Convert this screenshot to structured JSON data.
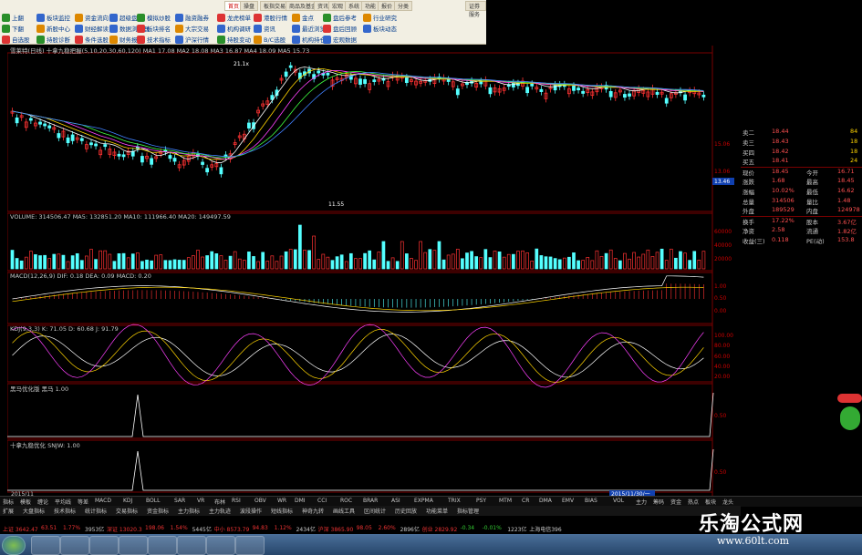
{
  "toolbar": {
    "tabs": [
      "首页",
      "操盘",
      "板指交易",
      "商品及基金",
      "资讯",
      "宏观",
      "系统",
      "功能",
      "报价",
      "分类",
      "证券服务"
    ],
    "active_tab": "首页",
    "items": [
      {
        "label": "上翻",
        "icon": "up-arrow-icon",
        "color": "#2a8f2a"
      },
      {
        "label": "下翻",
        "icon": "down-arrow-icon",
        "color": "#2a8f2a"
      },
      {
        "label": "自选股",
        "icon": "star-icon",
        "color": "#d33"
      },
      {
        "label": "板块监控",
        "icon": "grid-icon",
        "color": "#36c"
      },
      {
        "label": "新股中心",
        "icon": "flag-icon",
        "color": "#d80"
      },
      {
        "label": "持股诊断",
        "icon": "doctor-icon",
        "color": "#2a8f2a"
      },
      {
        "label": "资金流向",
        "icon": "money-icon",
        "color": "#d80"
      },
      {
        "label": "财经解读",
        "icon": "news-icon",
        "color": "#36c"
      },
      {
        "label": "条件选股",
        "icon": "filter-icon",
        "color": "#d33"
      },
      {
        "label": "超级盘口",
        "icon": "monitor-icon",
        "color": "#36c"
      },
      {
        "label": "数据浏览器",
        "icon": "browser-icon",
        "color": "#36c"
      },
      {
        "label": "财务报告",
        "icon": "report-icon",
        "color": "#d80"
      },
      {
        "label": "模拟炒股",
        "icon": "chart-icon",
        "color": "#2a8f2a"
      },
      {
        "label": "板块排名",
        "icon": "rank-icon",
        "color": "#d33"
      },
      {
        "label": "技术指标",
        "icon": "indicator-icon",
        "color": "#d33"
      },
      {
        "label": "融资融券",
        "icon": "loan-icon",
        "color": "#36c"
      },
      {
        "label": "大宗交易",
        "icon": "deal-icon",
        "color": "#d80"
      },
      {
        "label": "沪深行情",
        "icon": "market-icon",
        "color": "#36c"
      },
      {
        "label": "龙虎榜单",
        "icon": "dragon-icon",
        "color": "#d33"
      },
      {
        "label": "机构调研",
        "icon": "org-icon",
        "color": "#36c"
      },
      {
        "label": "持股变动",
        "icon": "change-icon",
        "color": "#2a8f2a"
      },
      {
        "label": "港股行情",
        "icon": "hk-icon",
        "color": "#d33"
      },
      {
        "label": "资讯",
        "icon": "info-icon",
        "color": "#36c"
      },
      {
        "label": "B/C选股",
        "icon": "bc-icon",
        "color": "#d80"
      },
      {
        "label": "金点",
        "icon": "gold-icon",
        "color": "#d80"
      },
      {
        "label": "最近浏览",
        "icon": "history-icon",
        "color": "#36c"
      },
      {
        "label": "机构持仓",
        "icon": "holding-icon",
        "color": "#36c"
      },
      {
        "label": "盘后参考",
        "icon": "reference-icon",
        "color": "#2a8f2a"
      },
      {
        "label": "盘后回顾",
        "icon": "review-icon",
        "color": "#d33"
      },
      {
        "label": "宏观数据",
        "icon": "macro-icon",
        "color": "#36c"
      },
      {
        "label": "行业研究",
        "icon": "industry-icon",
        "color": "#d80"
      },
      {
        "label": "板块动态",
        "icon": "sector-icon",
        "color": "#36c"
      }
    ]
  },
  "main_header": "雪莱特(日线) 十拿九稳把握(5,10,20,30,60,120)  MA1 17.08  MA2 18.08  MA3 16.87  MA4 18.09  MA5 15.73",
  "price_axis": [
    "15.06",
    "13.06"
  ],
  "last_price_tag": "13.46",
  "price_markers": [
    "21.1x",
    "11.55"
  ],
  "volume_header": "VOLUME: 314506.47  MA5: 132851.20  MA10: 111966.40  MA20: 149497.59",
  "volume_axis": [
    "60000",
    "40000",
    "20000"
  ],
  "macd_header": "MACD(12,26,9)  DIF: 0.18  DEA: 0.09  MACD: 0.20",
  "macd_axis": [
    "1.00",
    "0.50",
    "0.00"
  ],
  "kdj_header": "KDJ(9,3,3)  K: 71.05  D: 60.68  J: 91.79",
  "kdj_axis": [
    "100.00",
    "80.00",
    "60.00",
    "40.00",
    "20.00"
  ],
  "p4_header": "黑马优化版  黑马 1.00",
  "p4_axis": [
    "0.50"
  ],
  "p5_header": "十拿九稳优化  SNJW: 1.00",
  "p5_axis": [
    "0.50"
  ],
  "date_axis_start": "2015/11",
  "date_axis_end": "2015/11/30/一",
  "quote_panel": {
    "rows": [
      {
        "label": "卖二",
        "value": "18.44",
        "extra": "84"
      },
      {
        "label": "卖三",
        "value": "18.43",
        "extra": "18"
      },
      {
        "label": "买四",
        "value": "18.42",
        "extra": "18"
      },
      {
        "label": "买五",
        "value": "18.41",
        "extra": "24"
      },
      {
        "label": "现价",
        "value": "18.45",
        "label2": "今开",
        "value2": "16.71"
      },
      {
        "label": "涨跌",
        "value": "1.68",
        "label2": "最高",
        "value2": "18.45"
      },
      {
        "label": "涨幅",
        "value": "10.02%",
        "label2": "最低",
        "value2": "16.62"
      },
      {
        "label": "总量",
        "value": "314506",
        "label2": "量比",
        "value2": "1.48"
      },
      {
        "label": "外盘",
        "value": "189529",
        "label2": "内盘",
        "value2": "124978"
      },
      {
        "label": "换手",
        "value": "17.22%",
        "label2": "股本",
        "value2": "3.67亿"
      },
      {
        "label": "净资",
        "value": "2.58",
        "label2": "流通",
        "value2": "1.82亿"
      },
      {
        "label": "收益(三)",
        "value": "0.118",
        "label2": "PE(动)",
        "value2": "153.8"
      }
    ]
  },
  "func_bar": [
    "指标",
    "模板",
    "缠论",
    "平均线",
    "等差",
    "MACD",
    "KDJ",
    "BOLL",
    "SAR",
    "VR",
    "布林",
    "RSI",
    "OBV",
    "WR",
    "DMI",
    "CCI",
    "ROC",
    "BRAR",
    "ASI",
    "EXPMA",
    "TRIX",
    "PSY",
    "MTM",
    "CR",
    "DMA",
    "EMV",
    "BIAS",
    "VOL",
    "主力",
    "筹码",
    "资金",
    "热点",
    "板块",
    "龙头",
    "行业",
    "概念",
    "风格",
    "地域",
    "指数",
    "期货",
    "外汇",
    "港股",
    "美股",
    "基金",
    "债券",
    "扩展",
    "其他"
  ],
  "tab_bar": [
    "扩展",
    "大盘指标",
    "技术指标",
    "统计指标",
    "交易指标",
    "资金指标",
    "主力指标",
    "主力轨迹",
    "波段操作",
    "短线指标",
    "神奇九转",
    "画线工具",
    "区间统计",
    "历史回放",
    "功能菜单",
    "指标管理"
  ],
  "index_bar": [
    {
      "text": "上证 3642.47",
      "color": "#e33"
    },
    {
      "text": "63.51",
      "color": "#e33"
    },
    {
      "text": "1.77%",
      "color": "#e33"
    },
    {
      "text": "3953亿",
      "color": "#ccc"
    },
    {
      "text": "深证 13020.3",
      "color": "#e33"
    },
    {
      "text": "198.06",
      "color": "#e33"
    },
    {
      "text": "1.54%",
      "color": "#e33"
    },
    {
      "text": "5445亿",
      "color": "#ccc"
    },
    {
      "text": "中小 8573.79",
      "color": "#e33"
    },
    {
      "text": "94.83",
      "color": "#e33"
    },
    {
      "text": "1.12%",
      "color": "#e33"
    },
    {
      "text": "2434亿",
      "color": "#ccc"
    },
    {
      "text": "沪深 3865.90",
      "color": "#e33"
    },
    {
      "text": "98.05",
      "color": "#e33"
    },
    {
      "text": "2.60%",
      "color": "#e33"
    },
    {
      "text": "2896亿",
      "color": "#ccc"
    },
    {
      "text": "创业 2829.92",
      "color": "#e33"
    },
    {
      "text": "-0.34",
      "color": "#3c3"
    },
    {
      "text": "-0.01%",
      "color": "#3c3"
    },
    {
      "text": "1223亿",
      "color": "#ccc"
    },
    {
      "text": "上海电信396",
      "color": "#ccc"
    }
  ],
  "watermark": {
    "title": "乐淘公式网",
    "url": "www.60lt.com"
  },
  "colors": {
    "up": "#ff3232",
    "down": "#54ffff",
    "grid": "#7a0000",
    "accent": "#ffd400"
  }
}
